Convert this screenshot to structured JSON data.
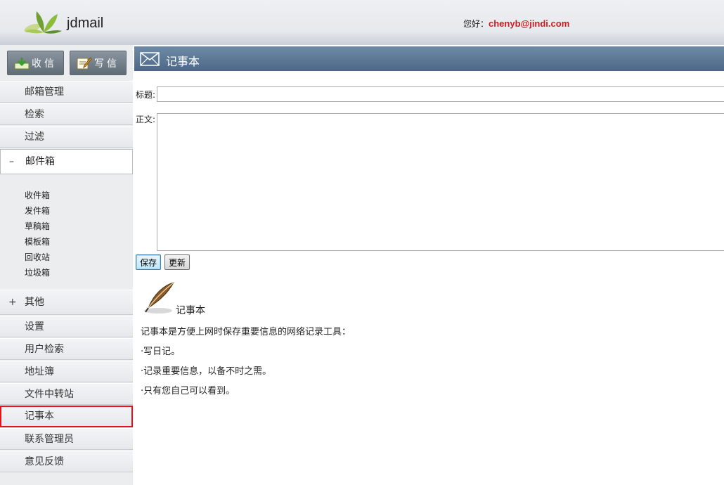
{
  "header": {
    "logo_text": "jdmail",
    "greeting_label": "您好：",
    "user_email": "chenyb@jindi.com"
  },
  "sidebar": {
    "receive_label": "收信",
    "write_label": "写信",
    "items_top": [
      "邮箱管理",
      "检索",
      "过滤"
    ],
    "mailbox_group": {
      "sign": "–",
      "label": "邮件箱"
    },
    "mailboxes": [
      "收件箱",
      "发件箱",
      "草稿箱",
      "模板箱",
      "回收站",
      "垃圾箱"
    ],
    "other_group": {
      "sign": "+",
      "label": "其他"
    },
    "items_other": [
      "设置",
      "用户检索",
      "地址簿",
      "文件中转站",
      "记事本",
      "联系管理员",
      "意见反馈"
    ],
    "selected_item": "记事本"
  },
  "main": {
    "title": "记事本",
    "subject_label": "标题:",
    "subject_value": "",
    "body_label": "正文:",
    "body_value": "",
    "save_label": "保存",
    "refresh_label": "更新",
    "intro_title": "记事本",
    "intro_desc": "记事本是方便上网时保存重要信息的网络记录工具：",
    "bullets": [
      "·写日记。",
      "·记录重要信息，以备不时之需。",
      "·只有您自己可以看到。"
    ]
  },
  "colors": {
    "accent_red": "#e0141a",
    "email_red": "#d0191f",
    "titlebar_blue": "#4c6886"
  }
}
